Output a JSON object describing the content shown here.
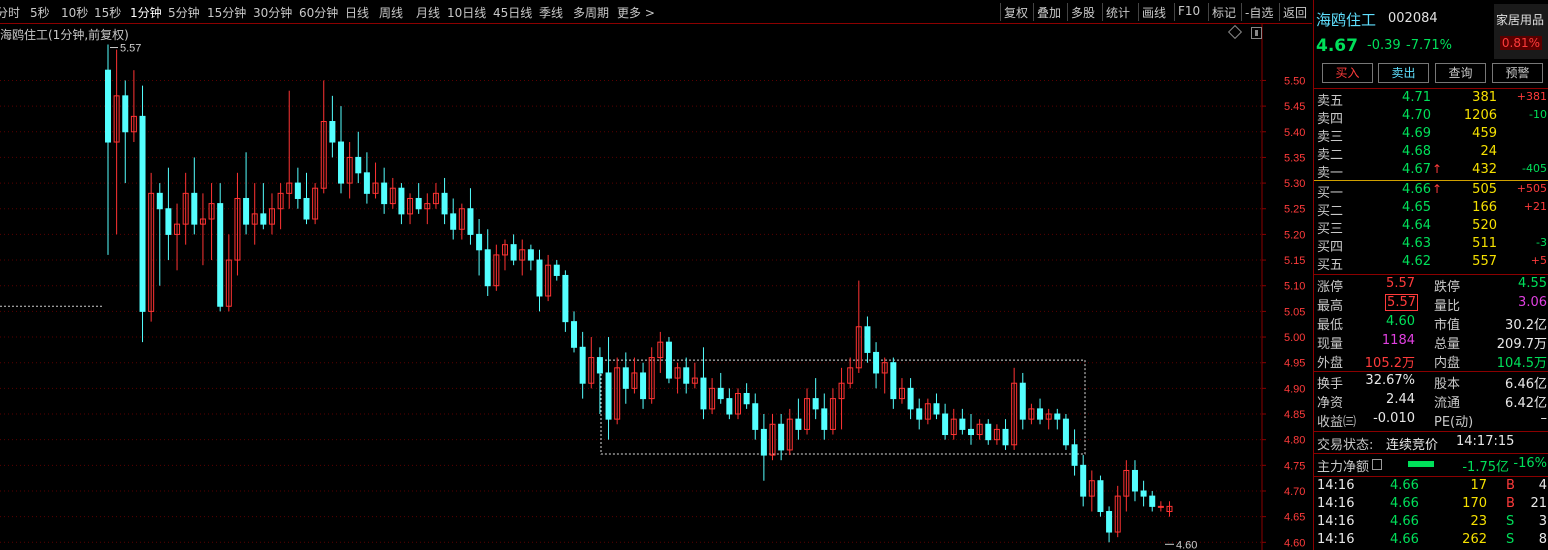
{
  "toolbar": {
    "periods": [
      "分时",
      "5秒",
      "10秒",
      "15秒",
      "1分钟",
      "5分钟",
      "15分钟",
      "30分钟",
      "60分钟",
      "日线",
      "周线",
      "月线",
      "10日线",
      "45日线",
      "季线",
      "多周期",
      "更多 >"
    ],
    "active_period": "1分钟",
    "right_buttons": [
      "复权",
      "叠加",
      "多股",
      "统计",
      "画线",
      "F10",
      "标记",
      "-自选",
      "返回"
    ]
  },
  "chart": {
    "title": "海鸥住工(1分钟,前复权)",
    "high_label": "5.57",
    "low_label": "4.60"
  },
  "chart_data": {
    "type": "candlestick",
    "title": "海鸥住工(1分钟,前复权)",
    "y_ticks": [
      "5.50",
      "5.45",
      "5.40",
      "5.35",
      "5.30",
      "5.25",
      "5.20",
      "5.15",
      "5.10",
      "5.05",
      "5.00",
      "4.95",
      "4.90",
      "4.85",
      "4.80",
      "4.75",
      "4.70",
      "4.65",
      "4.60"
    ],
    "ylim": [
      4.585,
      5.61
    ],
    "prev_close": 5.06,
    "high": 5.57,
    "low": 4.6,
    "up_color": "#ff3333",
    "down_color": "#54ffff",
    "candles": [
      [
        5.52,
        5.57,
        5.16,
        5.38
      ],
      [
        5.38,
        5.56,
        5.2,
        5.47
      ],
      [
        5.47,
        5.5,
        5.3,
        5.4
      ],
      [
        5.4,
        5.52,
        5.38,
        5.43
      ],
      [
        5.43,
        5.49,
        4.99,
        5.05
      ],
      [
        5.05,
        5.32,
        5.03,
        5.28
      ],
      [
        5.28,
        5.3,
        5.1,
        5.25
      ],
      [
        5.25,
        5.33,
        5.15,
        5.2
      ],
      [
        5.2,
        5.26,
        5.13,
        5.22
      ],
      [
        5.22,
        5.32,
        5.18,
        5.28
      ],
      [
        5.28,
        5.35,
        5.2,
        5.22
      ],
      [
        5.22,
        5.28,
        5.14,
        5.23
      ],
      [
        5.23,
        5.3,
        5.15,
        5.26
      ],
      [
        5.26,
        5.3,
        5.05,
        5.06
      ],
      [
        5.06,
        5.2,
        5.05,
        5.15
      ],
      [
        5.15,
        5.32,
        5.12,
        5.27
      ],
      [
        5.27,
        5.36,
        5.2,
        5.22
      ],
      [
        5.22,
        5.3,
        5.18,
        5.24
      ],
      [
        5.24,
        5.3,
        5.21,
        5.22
      ],
      [
        5.22,
        5.28,
        5.2,
        5.25
      ],
      [
        5.25,
        5.3,
        5.21,
        5.28
      ],
      [
        5.28,
        5.48,
        5.25,
        5.3
      ],
      [
        5.3,
        5.33,
        5.25,
        5.27
      ],
      [
        5.27,
        5.32,
        5.22,
        5.23
      ],
      [
        5.23,
        5.3,
        5.22,
        5.29
      ],
      [
        5.29,
        5.5,
        5.28,
        5.42
      ],
      [
        5.42,
        5.47,
        5.35,
        5.38
      ],
      [
        5.38,
        5.45,
        5.28,
        5.3
      ],
      [
        5.3,
        5.38,
        5.27,
        5.35
      ],
      [
        5.35,
        5.4,
        5.3,
        5.32
      ],
      [
        5.32,
        5.36,
        5.26,
        5.28
      ],
      [
        5.28,
        5.34,
        5.27,
        5.3
      ],
      [
        5.3,
        5.33,
        5.24,
        5.26
      ],
      [
        5.26,
        5.31,
        5.25,
        5.29
      ],
      [
        5.29,
        5.3,
        5.22,
        5.24
      ],
      [
        5.24,
        5.28,
        5.22,
        5.27
      ],
      [
        5.27,
        5.3,
        5.24,
        5.25
      ],
      [
        5.25,
        5.28,
        5.22,
        5.26
      ],
      [
        5.26,
        5.3,
        5.25,
        5.28
      ],
      [
        5.28,
        5.31,
        5.22,
        5.24
      ],
      [
        5.24,
        5.27,
        5.19,
        5.21
      ],
      [
        5.21,
        5.26,
        5.19,
        5.25
      ],
      [
        5.25,
        5.29,
        5.18,
        5.2
      ],
      [
        5.2,
        5.23,
        5.12,
        5.17
      ],
      [
        5.17,
        5.21,
        5.08,
        5.1
      ],
      [
        5.1,
        5.18,
        5.09,
        5.16
      ],
      [
        5.16,
        5.19,
        5.13,
        5.18
      ],
      [
        5.18,
        5.2,
        5.14,
        5.15
      ],
      [
        5.15,
        5.19,
        5.12,
        5.17
      ],
      [
        5.17,
        5.18,
        5.13,
        5.15
      ],
      [
        5.15,
        5.17,
        5.05,
        5.08
      ],
      [
        5.08,
        5.16,
        5.07,
        5.14
      ],
      [
        5.14,
        5.15,
        5.11,
        5.12
      ],
      [
        5.12,
        5.13,
        5.01,
        5.03
      ],
      [
        5.03,
        5.05,
        4.97,
        4.98
      ],
      [
        4.98,
        5.01,
        4.88,
        4.91
      ],
      [
        4.91,
        5.0,
        4.9,
        4.96
      ],
      [
        4.96,
        4.98,
        4.85,
        4.93
      ],
      [
        4.93,
        5.0,
        4.8,
        4.84
      ],
      [
        4.84,
        4.96,
        4.83,
        4.94
      ],
      [
        4.94,
        4.97,
        4.87,
        4.9
      ],
      [
        4.9,
        4.96,
        4.89,
        4.93
      ],
      [
        4.93,
        4.95,
        4.86,
        4.88
      ],
      [
        4.88,
        4.98,
        4.87,
        4.96
      ],
      [
        4.96,
        5.01,
        4.93,
        4.99
      ],
      [
        4.99,
        5.0,
        4.91,
        4.92
      ],
      [
        4.92,
        4.95,
        4.89,
        4.94
      ],
      [
        4.94,
        4.96,
        4.89,
        4.91
      ],
      [
        4.91,
        4.95,
        4.9,
        4.92
      ],
      [
        4.92,
        4.98,
        4.84,
        4.86
      ],
      [
        4.86,
        4.92,
        4.85,
        4.9
      ],
      [
        4.9,
        4.93,
        4.87,
        4.88
      ],
      [
        4.88,
        4.9,
        4.84,
        4.85
      ],
      [
        4.85,
        4.9,
        4.84,
        4.89
      ],
      [
        4.89,
        4.91,
        4.86,
        4.87
      ],
      [
        4.87,
        4.89,
        4.8,
        4.82
      ],
      [
        4.82,
        4.85,
        4.72,
        4.77
      ],
      [
        4.77,
        4.85,
        4.76,
        4.83
      ],
      [
        4.83,
        4.85,
        4.76,
        4.78
      ],
      [
        4.78,
        4.86,
        4.77,
        4.84
      ],
      [
        4.84,
        4.88,
        4.8,
        4.82
      ],
      [
        4.82,
        4.9,
        4.81,
        4.88
      ],
      [
        4.88,
        4.92,
        4.84,
        4.86
      ],
      [
        4.86,
        4.89,
        4.8,
        4.82
      ],
      [
        4.82,
        4.9,
        4.81,
        4.88
      ],
      [
        4.88,
        4.94,
        4.82,
        4.91
      ],
      [
        4.91,
        4.96,
        4.9,
        4.94
      ],
      [
        4.94,
        5.11,
        4.93,
        5.02
      ],
      [
        5.02,
        5.04,
        4.95,
        4.97
      ],
      [
        4.97,
        4.99,
        4.9,
        4.93
      ],
      [
        4.93,
        4.96,
        4.89,
        4.95
      ],
      [
        4.95,
        4.96,
        4.86,
        4.88
      ],
      [
        4.88,
        4.92,
        4.87,
        4.9
      ],
      [
        4.9,
        4.92,
        4.84,
        4.86
      ],
      [
        4.86,
        4.88,
        4.82,
        4.84
      ],
      [
        4.84,
        4.88,
        4.83,
        4.87
      ],
      [
        4.87,
        4.89,
        4.84,
        4.85
      ],
      [
        4.85,
        4.87,
        4.8,
        4.81
      ],
      [
        4.81,
        4.86,
        4.8,
        4.84
      ],
      [
        4.84,
        4.86,
        4.81,
        4.82
      ],
      [
        4.82,
        4.85,
        4.79,
        4.81
      ],
      [
        4.81,
        4.84,
        4.8,
        4.83
      ],
      [
        4.83,
        4.84,
        4.79,
        4.8
      ],
      [
        4.8,
        4.83,
        4.79,
        4.82
      ],
      [
        4.82,
        4.84,
        4.78,
        4.79
      ],
      [
        4.79,
        4.94,
        4.78,
        4.91
      ],
      [
        4.91,
        4.93,
        4.82,
        4.84
      ],
      [
        4.84,
        4.87,
        4.83,
        4.86
      ],
      [
        4.86,
        4.88,
        4.83,
        4.84
      ],
      [
        4.84,
        4.86,
        4.82,
        4.85
      ],
      [
        4.85,
        4.86,
        4.82,
        4.84
      ],
      [
        4.84,
        4.85,
        4.78,
        4.79
      ],
      [
        4.79,
        4.82,
        4.73,
        4.75
      ],
      [
        4.75,
        4.77,
        4.67,
        4.69
      ],
      [
        4.69,
        4.74,
        4.66,
        4.72
      ],
      [
        4.72,
        4.73,
        4.65,
        4.66
      ],
      [
        4.66,
        4.67,
        4.6,
        4.62
      ],
      [
        4.62,
        4.71,
        4.61,
        4.69
      ],
      [
        4.69,
        4.76,
        4.66,
        4.74
      ],
      [
        4.74,
        4.76,
        4.68,
        4.7
      ],
      [
        4.7,
        4.72,
        4.67,
        4.69
      ],
      [
        4.69,
        4.7,
        4.66,
        4.67
      ],
      [
        4.67,
        4.68,
        4.66,
        4.67
      ],
      [
        4.66,
        4.68,
        4.65,
        4.67
      ]
    ]
  },
  "stock": {
    "name": "海鸥住工",
    "code": "002084",
    "sector": "家居用品",
    "sector_pct": "0.81%",
    "price": "4.67",
    "change": "-0.39",
    "change_pct": "-7.71%"
  },
  "actions": {
    "buy": "买入",
    "sell": "卖出",
    "query": "查询",
    "alert": "预警"
  },
  "orderbook": {
    "asks": [
      {
        "label": "卖五",
        "price": "4.71",
        "vol": "381",
        "delta": "+381",
        "arrow": ""
      },
      {
        "label": "卖四",
        "price": "4.70",
        "vol": "1206",
        "delta": "-10",
        "arrow": ""
      },
      {
        "label": "卖三",
        "price": "4.69",
        "vol": "459",
        "delta": "",
        "arrow": ""
      },
      {
        "label": "卖二",
        "price": "4.68",
        "vol": "24",
        "delta": "",
        "arrow": ""
      },
      {
        "label": "卖一",
        "price": "4.67",
        "vol": "432",
        "delta": "-405",
        "arrow": "↑"
      }
    ],
    "bids": [
      {
        "label": "买一",
        "price": "4.66",
        "vol": "505",
        "delta": "+505",
        "arrow": "↑"
      },
      {
        "label": "买二",
        "price": "4.65",
        "vol": "166",
        "delta": "+21",
        "arrow": ""
      },
      {
        "label": "买三",
        "price": "4.64",
        "vol": "520",
        "delta": "",
        "arrow": ""
      },
      {
        "label": "买四",
        "price": "4.63",
        "vol": "511",
        "delta": "-3",
        "arrow": ""
      },
      {
        "label": "买五",
        "price": "4.62",
        "vol": "557",
        "delta": "+5",
        "arrow": ""
      }
    ]
  },
  "stats": {
    "limit_up_label": "涨停",
    "limit_up": "5.57",
    "limit_down_label": "跌停",
    "limit_down": "4.55",
    "high_label": "最高",
    "high": "5.57",
    "vol_ratio_label": "量比",
    "vol_ratio": "3.06",
    "low_label": "最低",
    "low": "4.60",
    "mktcap_label": "市值",
    "mktcap": "30.2亿",
    "cur_vol_label": "现量",
    "cur_vol": "1184",
    "total_vol_label": "总量",
    "total_vol": "209.7万",
    "outer_label": "外盘",
    "outer": "105.2万",
    "inner_label": "内盘",
    "inner": "104.5万",
    "turnover_label": "换手",
    "turnover": "32.67%",
    "share_label": "股本",
    "share": "6.46亿",
    "nav_label": "净资",
    "nav": "2.44",
    "float_label": "流通",
    "float": "6.42亿",
    "eps_label": "收益㈢",
    "eps": "-0.010",
    "pe_label": "PE(动)",
    "pe": "–"
  },
  "status": {
    "label": "交易状态:",
    "value": "连续竞价",
    "time": "14:17:15"
  },
  "netflow": {
    "label": "主力净额",
    "value": "-1.75亿",
    "pct": "-16%"
  },
  "ticks": [
    {
      "time": "14:16",
      "price": "4.66",
      "vol": "17",
      "side": "B",
      "count": "4"
    },
    {
      "time": "14:16",
      "price": "4.66",
      "vol": "170",
      "side": "B",
      "count": "21"
    },
    {
      "time": "14:16",
      "price": "4.66",
      "vol": "23",
      "side": "S",
      "count": "3"
    },
    {
      "time": "14:16",
      "price": "4.66",
      "vol": "262",
      "side": "S",
      "count": "8"
    }
  ]
}
